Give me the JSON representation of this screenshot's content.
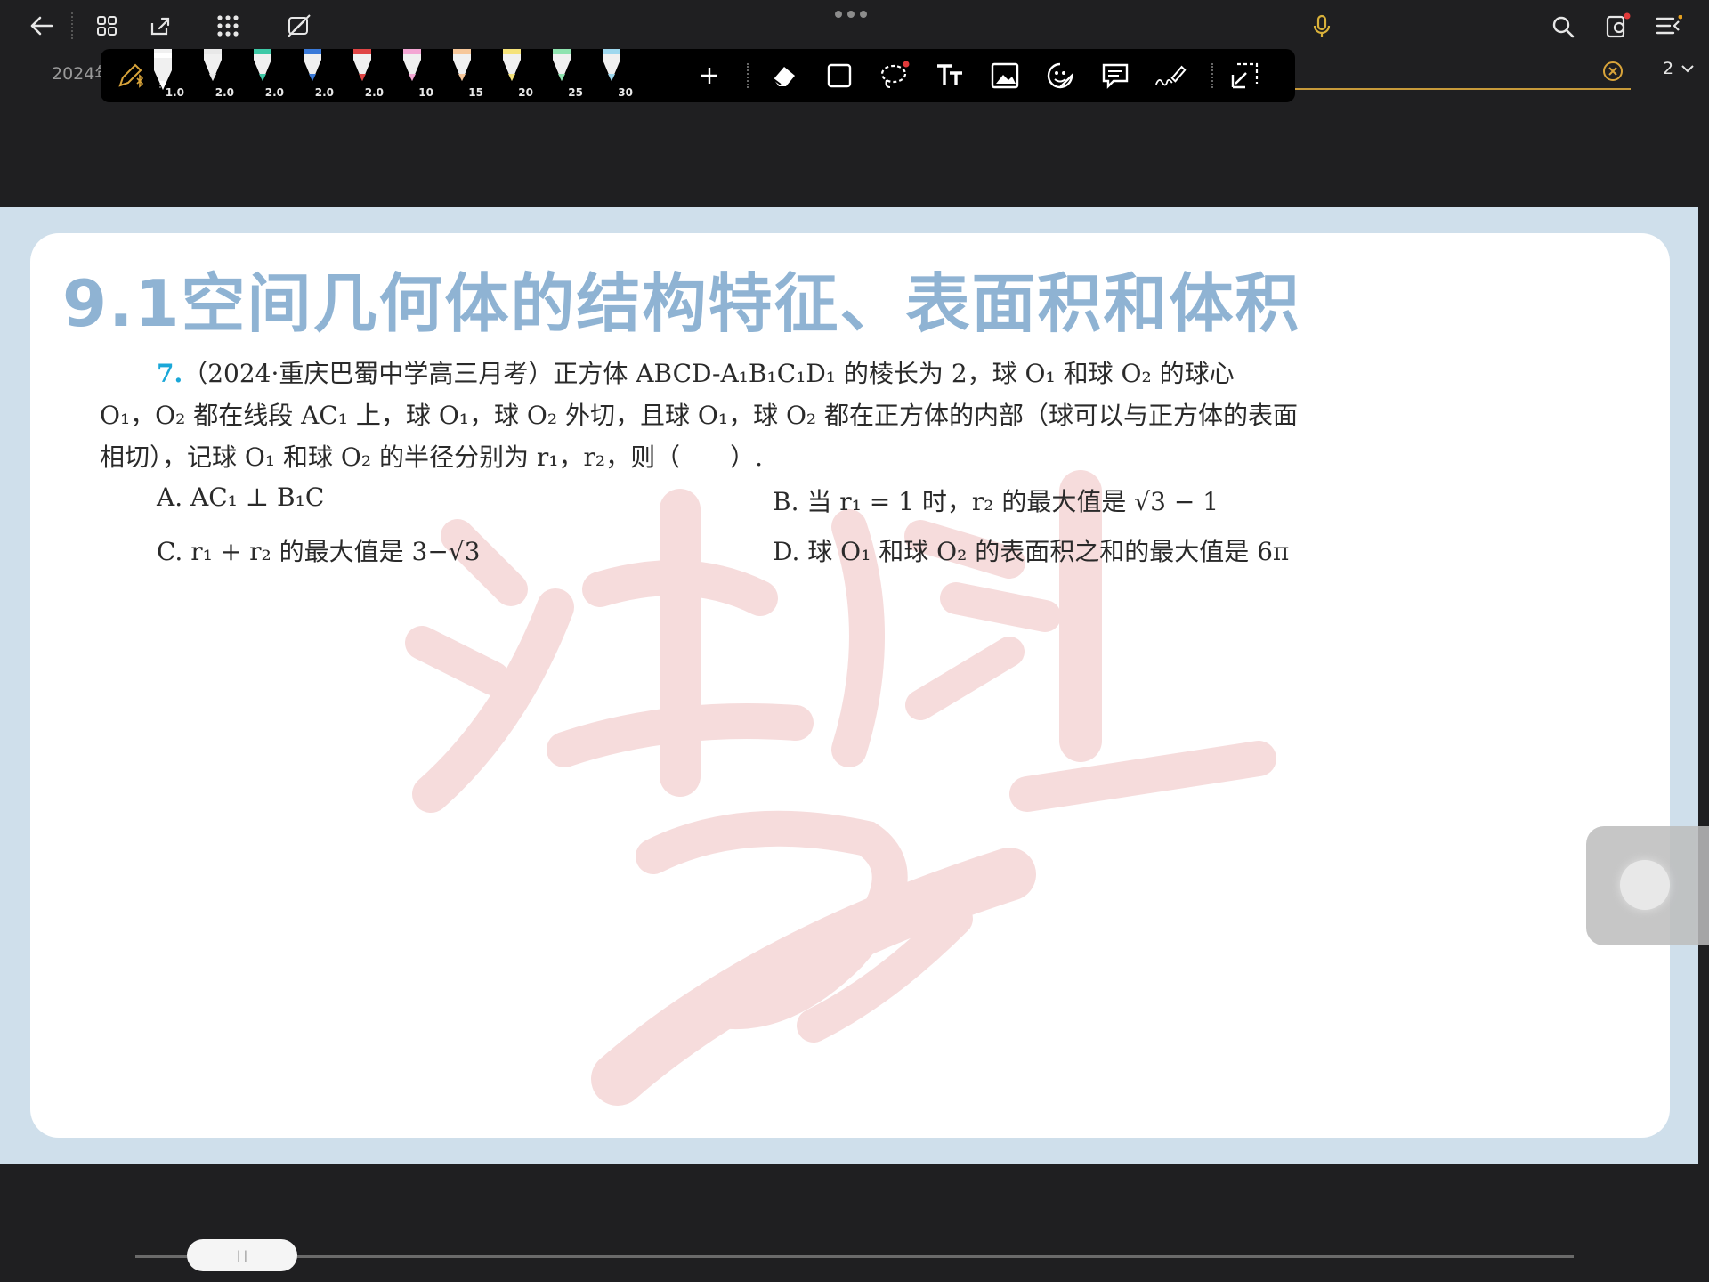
{
  "topbar": {
    "tab_title": "2024年",
    "page_number": "2",
    "icons": [
      "back-arrow-icon",
      "grid-icon",
      "export-icon",
      "apps-icon",
      "no-pen-icon",
      "more-dots-icon",
      "microphone-icon",
      "search-icon",
      "settings-doc-icon",
      "outline-menu-icon"
    ]
  },
  "pen_toolbar": {
    "pens": [
      {
        "size": "1.0",
        "color": "#ffffff"
      },
      {
        "size": "2.0",
        "color": "#e8e8e8"
      },
      {
        "size": "2.0",
        "color": "#3ec9a7"
      },
      {
        "size": "2.0",
        "color": "#3a7ad9"
      },
      {
        "size": "2.0",
        "color": "#e04545"
      },
      {
        "size": "10",
        "color": "#f4a7d4"
      },
      {
        "size": "15",
        "color": "#f6c79a"
      },
      {
        "size": "20",
        "color": "#f5e27a"
      },
      {
        "size": "25",
        "color": "#8fe3b0"
      },
      {
        "size": "30",
        "color": "#9fd8ee"
      }
    ],
    "tools": [
      "add-icon",
      "eraser-icon",
      "shape-icon",
      "lasso-icon",
      "text-icon",
      "image-icon",
      "sticker-icon",
      "comment-icon",
      "signature-icon",
      "crop-icon"
    ]
  },
  "document": {
    "chapter_title": "9.1空间几何体的结构特征、表面积和体积",
    "problem_number": "7.",
    "problem_line1": "（2024·重庆巴蜀中学高三月考）正方体 ABCD-A₁B₁C₁D₁ 的棱长为 2，球 O₁ 和球 O₂ 的球心",
    "problem_line2": "O₁，O₂ 都在线段 AC₁ 上，球 O₁，球 O₂ 外切，且球 O₁，球 O₂ 都在正方体的内部（球可以与正方体的表面",
    "problem_line3": "相切），记球 O₁ 和球 O₂ 的半径分别为 r₁，r₂，则（　　）.",
    "option_a": "A. AC₁ ⊥ B₁C",
    "option_b": "B. 当 r₁ = 1 时，r₂ 的最大值是 √3 − 1",
    "option_c": "C. r₁ + r₂ 的最大值是 3−√3",
    "option_d": "D. 球 O₁ 和球 O₂ 的表面积之和的最大值是 6π"
  },
  "scrollbar": {
    "thumb_label": "| |"
  }
}
